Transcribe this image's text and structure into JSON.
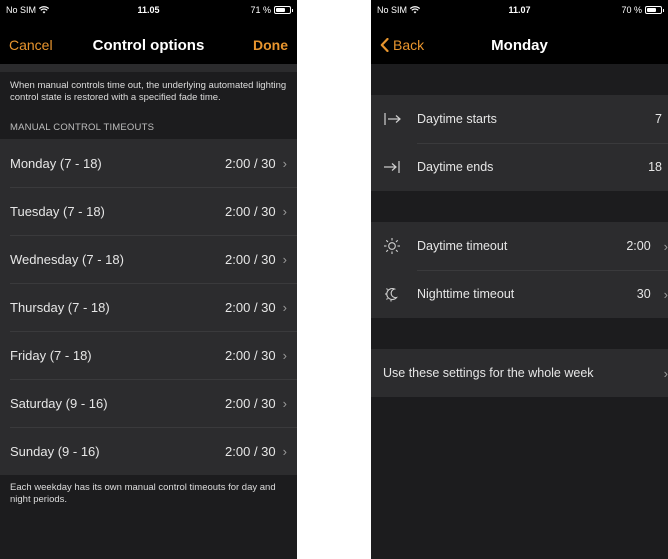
{
  "colors": {
    "accent": "#e8952e",
    "background": "#000000",
    "group": "#2c2c2e"
  },
  "left": {
    "status": {
      "carrier": "No SIM",
      "time": "11.05",
      "battery": "71 %",
      "battery_level": 0.71
    },
    "nav": {
      "cancel_label": "Cancel",
      "title": "Control options",
      "done_label": "Done"
    },
    "info_text": "When manual controls time out, the underlying automated lighting control state is restored with a specified fade time.",
    "section_header": "MANUAL CONTROL TIMEOUTS",
    "days": [
      {
        "label": "Monday (7 - 18)",
        "value": "2:00 / 30"
      },
      {
        "label": "Tuesday (7 - 18)",
        "value": "2:00 / 30"
      },
      {
        "label": "Wednesday (7 - 18)",
        "value": "2:00 / 30"
      },
      {
        "label": "Thursday (7 - 18)",
        "value": "2:00 / 30"
      },
      {
        "label": "Friday (7 - 18)",
        "value": "2:00 / 30"
      },
      {
        "label": "Saturday (9 - 16)",
        "value": "2:00 / 30"
      },
      {
        "label": "Sunday (9 - 16)",
        "value": "2:00 / 30"
      }
    ],
    "footer_text": "Each weekday has its own manual control timeouts for day and night periods."
  },
  "right": {
    "status": {
      "carrier": "No SIM",
      "time": "11.07",
      "battery": "70 %",
      "battery_level": 0.7
    },
    "nav": {
      "back_label": "Back",
      "title": "Monday"
    },
    "daytime": {
      "starts_label": "Daytime starts",
      "starts_value": "7",
      "ends_label": "Daytime ends",
      "ends_value": "18"
    },
    "timeouts": {
      "day_label": "Daytime timeout",
      "day_value": "2:00",
      "night_label": "Nighttime timeout",
      "night_value": "30"
    },
    "apply_label": "Use these settings for the whole week"
  }
}
